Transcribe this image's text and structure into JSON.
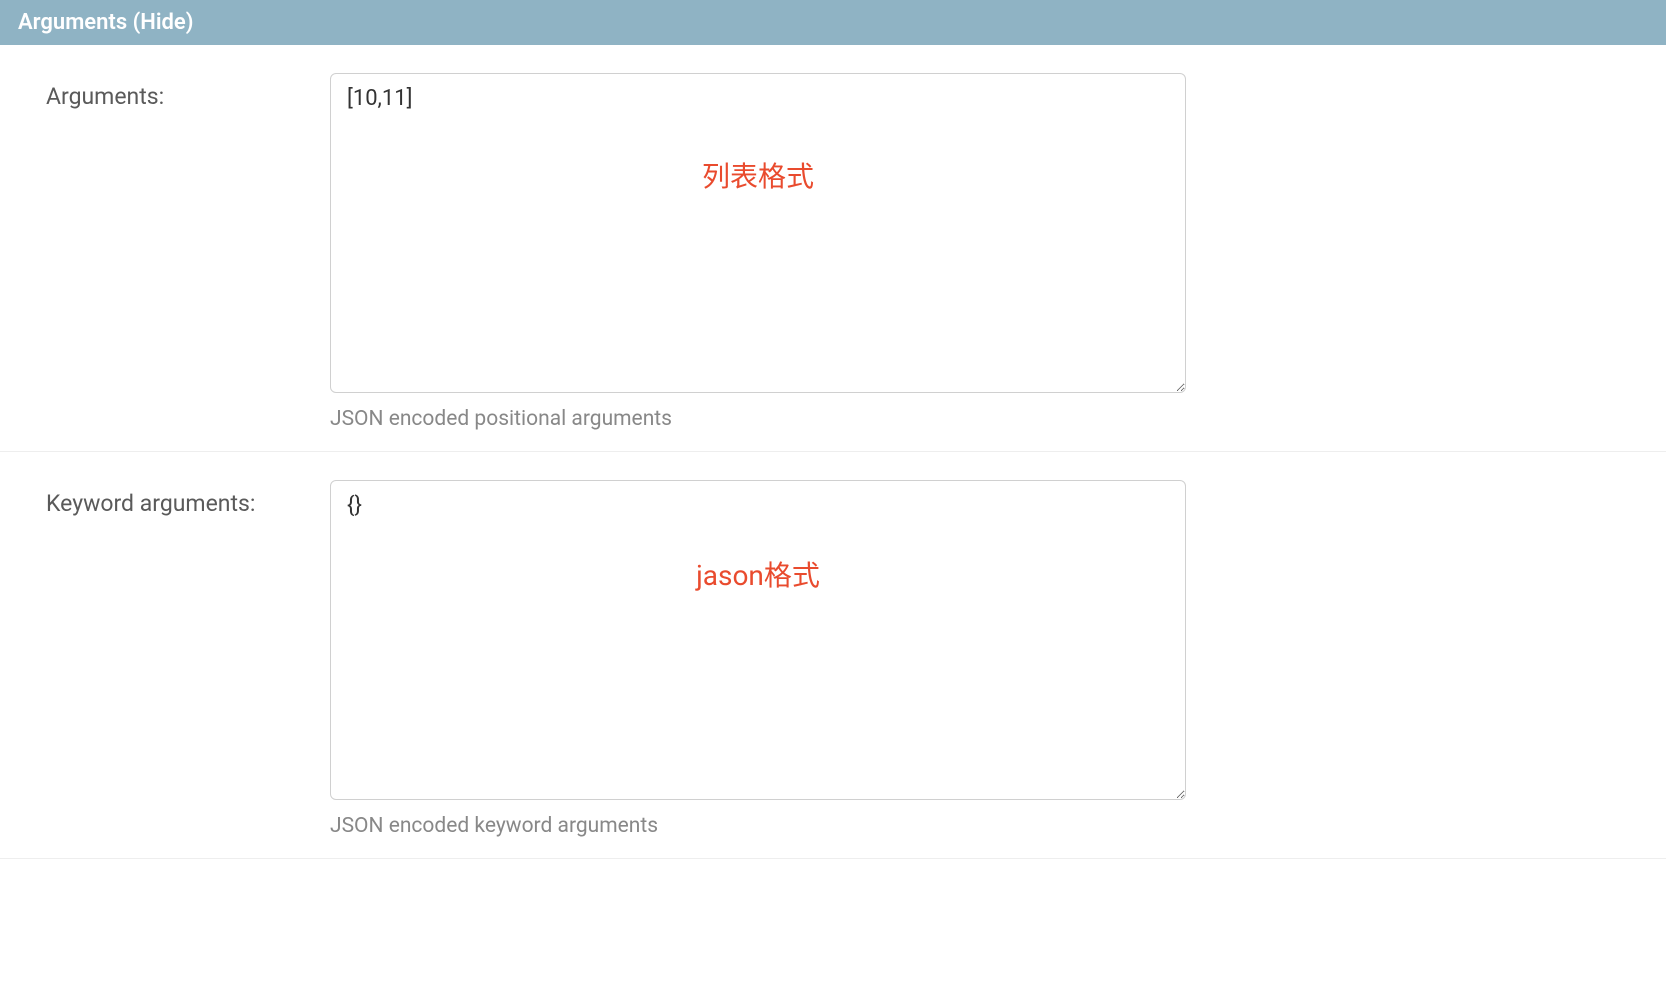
{
  "header": {
    "title_prefix": "Arguments",
    "hide_text": "(Hide)"
  },
  "fields": {
    "arguments": {
      "label": "Arguments:",
      "value": "[10,11]",
      "help": "JSON encoded positional arguments",
      "annotation": "列表格式"
    },
    "kwargs": {
      "label": "Keyword arguments:",
      "value": "{}",
      "help": "JSON encoded keyword arguments",
      "annotation": "jason格式"
    }
  }
}
